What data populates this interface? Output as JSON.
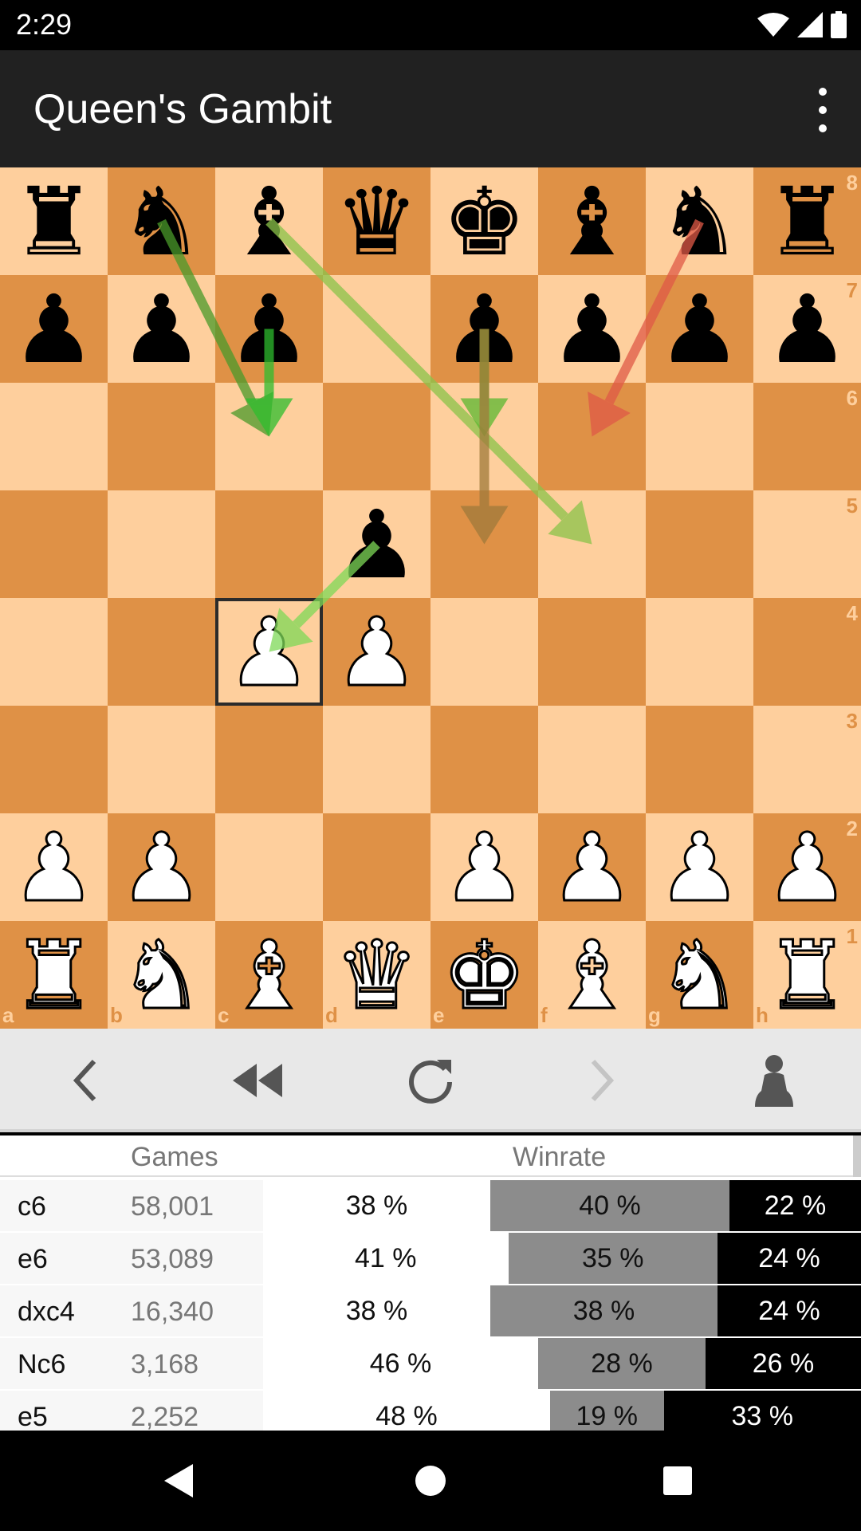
{
  "status": {
    "time": "2:29"
  },
  "app": {
    "title": "Queen's Gambit"
  },
  "board": {
    "ranks": [
      "8",
      "7",
      "6",
      "5",
      "4",
      "3",
      "2",
      "1"
    ],
    "files": [
      "a",
      "b",
      "c",
      "d",
      "e",
      "f",
      "g",
      "h"
    ],
    "position": [
      [
        "br",
        "bn",
        "bb",
        "bq",
        "bk",
        "bb",
        "bn",
        "br"
      ],
      [
        "bp",
        "bp",
        "bp",
        "",
        "bp",
        "bp",
        "bp",
        "bp"
      ],
      [
        "",
        "",
        "",
        "",
        "",
        "",
        "",
        ""
      ],
      [
        "",
        "",
        "",
        "bp",
        "",
        "",
        "",
        ""
      ],
      [
        "",
        "",
        "wp",
        "wp",
        "",
        "",
        "",
        ""
      ],
      [
        "",
        "",
        "",
        "",
        "",
        "",
        "",
        ""
      ],
      [
        "wp",
        "wp",
        "",
        "",
        "wp",
        "wp",
        "wp",
        "wp"
      ],
      [
        "wr",
        "wn",
        "wb",
        "wq",
        "wk",
        "wb",
        "wn",
        "wr"
      ]
    ],
    "last_move_square": "c4",
    "arrows": [
      {
        "from": "b8",
        "to": "c6",
        "color": "#4a9a2a"
      },
      {
        "from": "c7",
        "to": "c6",
        "color": "#2ebd2e"
      },
      {
        "from": "c8",
        "to": "f5",
        "color": "#8bc34a"
      },
      {
        "from": "e7",
        "to": "e6",
        "color": "#5bb830"
      },
      {
        "from": "e7",
        "to": "e5",
        "color": "#a07a3a"
      },
      {
        "from": "g8",
        "to": "f6",
        "color": "#e05a47"
      },
      {
        "from": "d5",
        "to": "c4",
        "color": "#7ed957"
      }
    ],
    "colors": {
      "light": "#fecf9d",
      "dark": "#df9146"
    }
  },
  "controls": {
    "icons": [
      "chevron-left-icon",
      "rewind-icon",
      "refresh-icon",
      "chevron-right-icon",
      "player-icon"
    ]
  },
  "table": {
    "headers": {
      "games": "Games",
      "winrate": "Winrate"
    },
    "rows": [
      {
        "move": "c6",
        "games": "58,001",
        "white": "38 %",
        "draw": "40 %",
        "black": "22 %",
        "w": 38,
        "d": 40,
        "b": 22
      },
      {
        "move": "e6",
        "games": "53,089",
        "white": "41 %",
        "draw": "35 %",
        "black": "24 %",
        "w": 41,
        "d": 35,
        "b": 24
      },
      {
        "move": "dxc4",
        "games": "16,340",
        "white": "38 %",
        "draw": "38 %",
        "black": "24 %",
        "w": 38,
        "d": 38,
        "b": 24
      },
      {
        "move": "Nc6",
        "games": "3,168",
        "white": "46 %",
        "draw": "28 %",
        "black": "26 %",
        "w": 46,
        "d": 28,
        "b": 26
      },
      {
        "move": "e5",
        "games": "2,252",
        "white": "48 %",
        "draw": "19 %",
        "black": "33 %",
        "w": 48,
        "d": 19,
        "b": 33
      }
    ]
  }
}
